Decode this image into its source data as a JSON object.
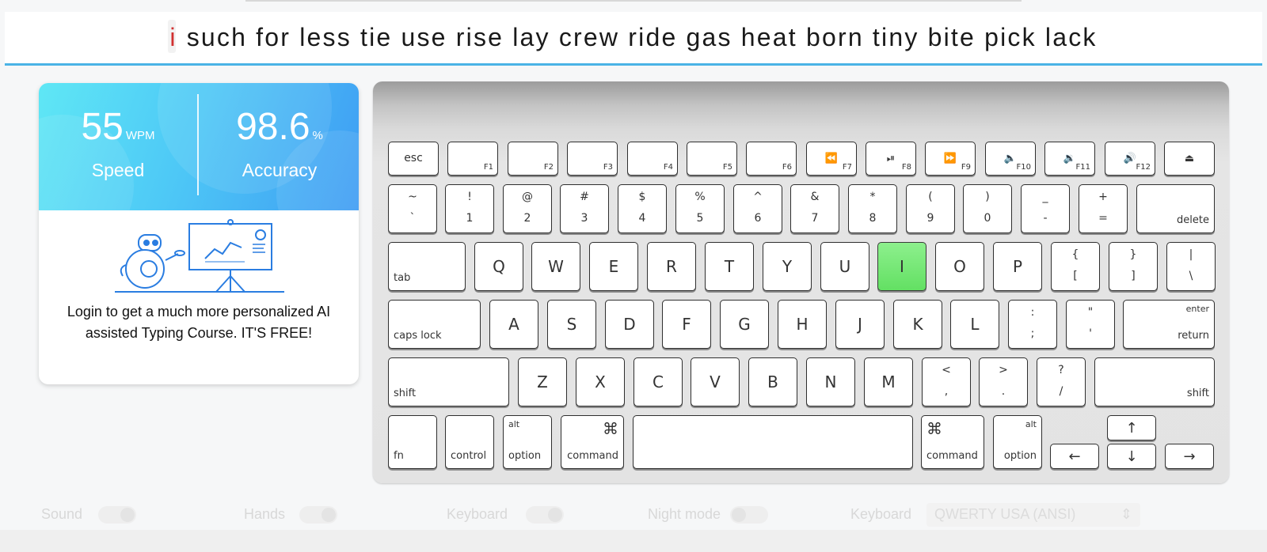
{
  "typing": {
    "current_char": "i",
    "remaining_text": "such for less tie use rise lay crew ride gas heat born tiny bite pick lack"
  },
  "stats": {
    "speed_value": "55",
    "speed_unit": "WPM",
    "speed_label": "Speed",
    "accuracy_value": "98.6",
    "accuracy_unit": "%",
    "accuracy_label": "Accuracy"
  },
  "promo": {
    "text": "Login to get a much more personalized AI assisted Typing Course. IT'S FREE!"
  },
  "keyboard": {
    "highlighted_key": "I",
    "highlight_color": "#63e063",
    "row_fn": [
      {
        "label": "esc"
      },
      {
        "fn": "F1"
      },
      {
        "fn": "F2"
      },
      {
        "fn": "F3"
      },
      {
        "fn": "F4"
      },
      {
        "fn": "F5"
      },
      {
        "fn": "F6"
      },
      {
        "fn": "F7",
        "icon": "⏪"
      },
      {
        "fn": "F8",
        "icon": "⏯"
      },
      {
        "fn": "F9",
        "icon": "⏩"
      },
      {
        "fn": "F10",
        "icon": "🔈"
      },
      {
        "fn": "F11",
        "icon": "🔉"
      },
      {
        "fn": "F12",
        "icon": "🔊"
      },
      {
        "icon": "⏏"
      }
    ],
    "row_num": [
      {
        "top": "~",
        "bot": "`"
      },
      {
        "top": "!",
        "bot": "1"
      },
      {
        "top": "@",
        "bot": "2"
      },
      {
        "top": "#",
        "bot": "3"
      },
      {
        "top": "$",
        "bot": "4"
      },
      {
        "top": "%",
        "bot": "5"
      },
      {
        "top": "^",
        "bot": "6"
      },
      {
        "top": "&",
        "bot": "7"
      },
      {
        "top": "*",
        "bot": "8"
      },
      {
        "top": "(",
        "bot": "9"
      },
      {
        "top": ")",
        "bot": "0"
      },
      {
        "top": "_",
        "bot": "-"
      },
      {
        "top": "+",
        "bot": "="
      },
      {
        "br": "delete"
      }
    ],
    "row_q": [
      {
        "bl": "tab"
      },
      {
        "main": "Q"
      },
      {
        "main": "W"
      },
      {
        "main": "E"
      },
      {
        "main": "R"
      },
      {
        "main": "T"
      },
      {
        "main": "Y"
      },
      {
        "main": "U"
      },
      {
        "main": "I"
      },
      {
        "main": "O"
      },
      {
        "main": "P"
      },
      {
        "top": "{",
        "bot": "["
      },
      {
        "top": "}",
        "bot": "]"
      },
      {
        "top": "|",
        "bot": "\\"
      }
    ],
    "row_a": [
      {
        "bl": "caps lock"
      },
      {
        "main": "A"
      },
      {
        "main": "S"
      },
      {
        "main": "D"
      },
      {
        "main": "F"
      },
      {
        "main": "G"
      },
      {
        "main": "H"
      },
      {
        "main": "J"
      },
      {
        "main": "K"
      },
      {
        "main": "L"
      },
      {
        "top": ":",
        "bot": ";"
      },
      {
        "top": "\"",
        "bot": "'"
      },
      {
        "tr": "enter",
        "br": "return"
      }
    ],
    "row_z": [
      {
        "bl": "shift"
      },
      {
        "main": "Z"
      },
      {
        "main": "X"
      },
      {
        "main": "C"
      },
      {
        "main": "V"
      },
      {
        "main": "B"
      },
      {
        "main": "N"
      },
      {
        "main": "M"
      },
      {
        "top": "<",
        "bot": ","
      },
      {
        "top": ">",
        "bot": "."
      },
      {
        "top": "?",
        "bot": "/"
      },
      {
        "br": "shift"
      }
    ],
    "row_bottom": [
      {
        "bl": "fn"
      },
      {
        "bl": "control"
      },
      {
        "tl": "alt",
        "bl": "option"
      },
      {
        "cmd": "⌘",
        "br": "command"
      },
      {
        "label": ""
      },
      {
        "cmdl": "⌘",
        "bl": "command"
      },
      {
        "tr": "alt",
        "br": "option"
      },
      {
        "icon": "↑"
      },
      {
        "icon": "←"
      },
      {
        "icon": "↓"
      },
      {
        "icon": "→"
      }
    ]
  },
  "footer": {
    "sound_label": "Sound",
    "hands_label": "Hands",
    "keyboard_toggle_label": "Keyboard",
    "night_mode_label": "Night mode",
    "layout_label": "Keyboard",
    "layout_value": "QWERTY USA (ANSI)"
  }
}
